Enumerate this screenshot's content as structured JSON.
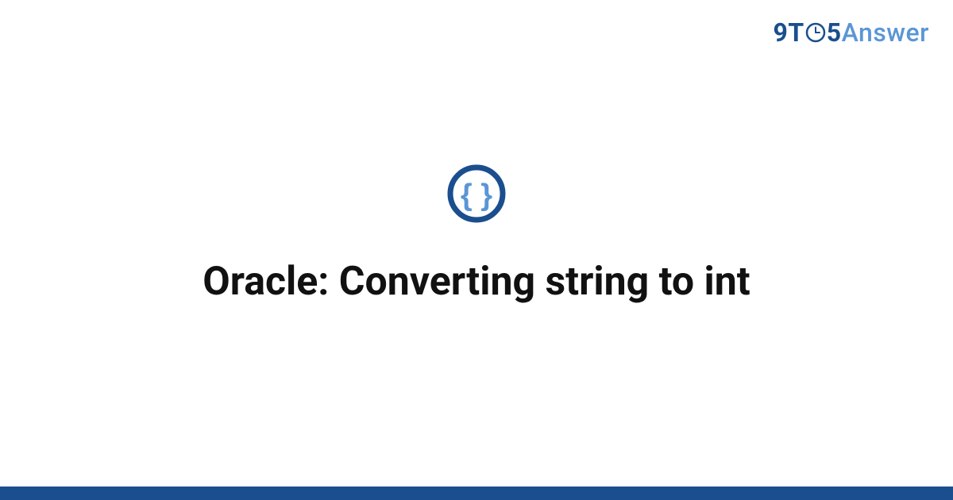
{
  "logo": {
    "part1": "9T",
    "part2": "5",
    "part3": "Answer"
  },
  "icon": {
    "name": "code-braces-icon"
  },
  "title": "Oracle: Converting string to int",
  "colors": {
    "primary": "#1a4e8e",
    "secondary": "#5a96d6",
    "text": "#111111"
  }
}
